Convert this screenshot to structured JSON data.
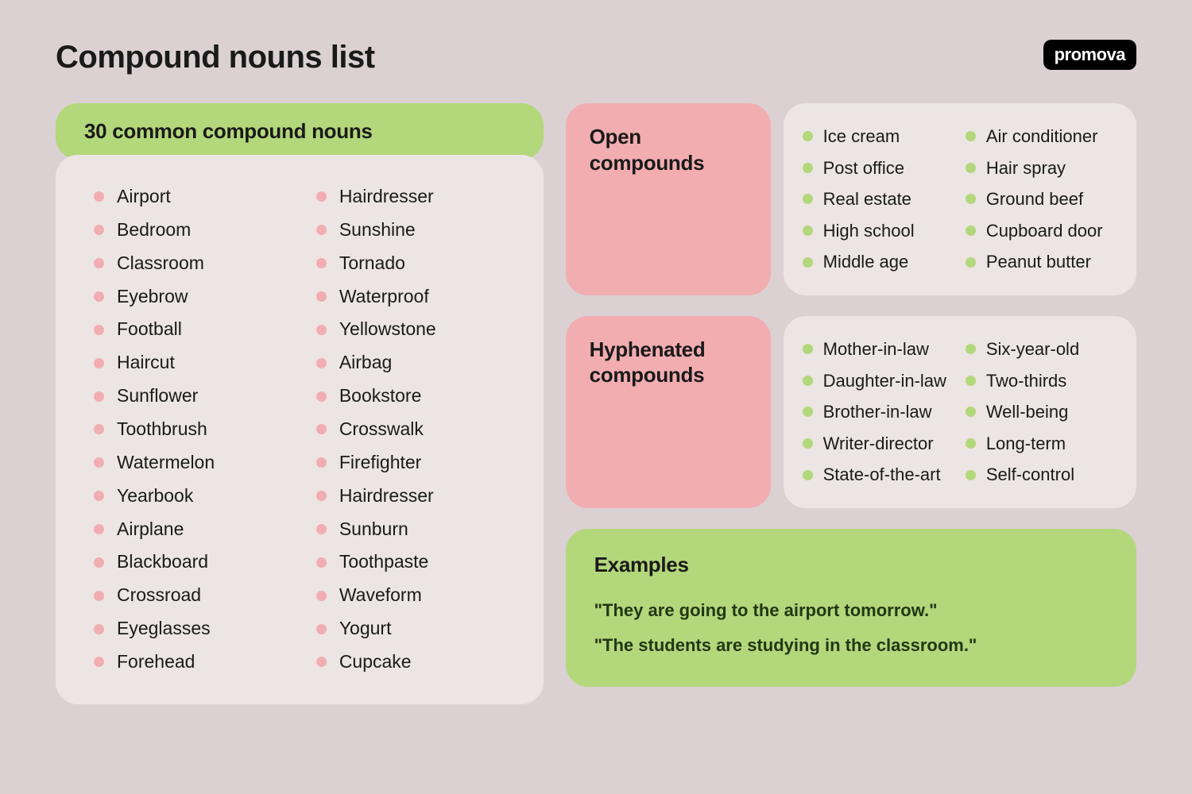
{
  "header": {
    "title": "Compound nouns list",
    "logo": "promova"
  },
  "mainSection": {
    "heading": "30 common compound nouns",
    "col1": [
      "Airport",
      "Bedroom",
      "Classroom",
      "Eyebrow",
      "Football",
      "Haircut",
      "Sunflower",
      "Toothbrush",
      "Watermelon",
      "Yearbook",
      "Airplane",
      "Blackboard",
      "Crossroad",
      "Eyeglasses",
      "Forehead"
    ],
    "col2": [
      "Hairdresser",
      "Sunshine",
      "Tornado",
      "Waterproof",
      "Yellowstone",
      "Airbag",
      "Bookstore",
      "Crosswalk",
      "Firefighter",
      "Hairdresser",
      "Sunburn",
      "Toothpaste",
      "Waveform",
      "Yogurt",
      "Cupcake"
    ]
  },
  "openCompounds": {
    "label": "Open compounds",
    "col1": [
      "Ice cream",
      "Post office",
      "Real estate",
      "High school",
      "Middle age"
    ],
    "col2": [
      "Air conditioner",
      "Hair spray",
      "Ground beef",
      "Cupboard door",
      "Peanut butter"
    ]
  },
  "hyphenated": {
    "label": "Hyphenated compounds",
    "col1": [
      "Mother-in-law",
      "Daughter-in-law",
      "Brother-in-law",
      "Writer-director",
      "State-of-the-art"
    ],
    "col2": [
      "Six-year-old",
      "Two-thirds",
      "Well-being",
      "Long-term",
      "Self-control"
    ]
  },
  "examples": {
    "heading": "Examples",
    "items": [
      "\"They are going to the airport tomorrow.\"",
      "\"The students are studying in the classroom.\""
    ]
  }
}
